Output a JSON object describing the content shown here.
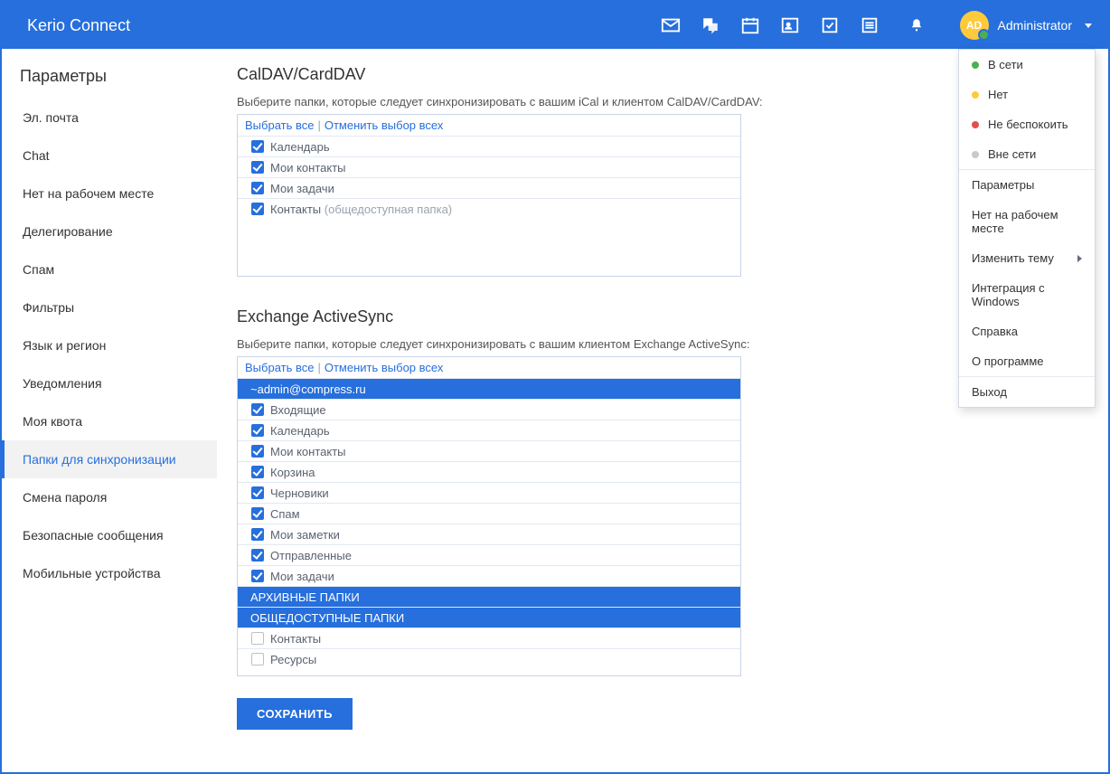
{
  "brand": "Kerio Connect",
  "user": {
    "initials": "AD",
    "name": "Administrator"
  },
  "sidebar": {
    "title": "Параметры",
    "items": [
      {
        "label": "Эл. почта"
      },
      {
        "label": "Chat"
      },
      {
        "label": "Нет на рабочем месте"
      },
      {
        "label": "Делегирование"
      },
      {
        "label": "Спам"
      },
      {
        "label": "Фильтры"
      },
      {
        "label": "Язык и регион"
      },
      {
        "label": "Уведомления"
      },
      {
        "label": "Моя квота"
      },
      {
        "label": "Папки для синхронизации",
        "active": true
      },
      {
        "label": "Смена пароля"
      },
      {
        "label": "Безопасные сообщения"
      },
      {
        "label": "Мобильные устройства"
      }
    ]
  },
  "caldav": {
    "title": "CalDAV/CardDAV",
    "desc": "Выберите папки, которые следует синхронизировать с вашим iCal и клиентом CalDAV/CardDAV:",
    "select_all": "Выбрать все",
    "deselect_all": "Отменить выбор всех",
    "rows": [
      {
        "label": "Календарь",
        "checked": true
      },
      {
        "label": "Мои контакты",
        "checked": true
      },
      {
        "label": "Мои задачи",
        "checked": true
      },
      {
        "label": "Контакты",
        "note": "(общедоступная папка)",
        "checked": true
      }
    ]
  },
  "eas": {
    "title": "Exchange ActiveSync",
    "desc": "Выберите папки, которые следует синхронизировать с вашим клиентом Exchange ActiveSync:",
    "select_all": "Выбрать все",
    "deselect_all": "Отменить выбор всех",
    "account_header": "~admin@compress.ru",
    "rows": [
      {
        "label": "Входящие",
        "checked": true
      },
      {
        "label": "Календарь",
        "checked": true
      },
      {
        "label": "Мои контакты",
        "checked": true
      },
      {
        "label": "Корзина",
        "checked": true
      },
      {
        "label": "Черновики",
        "checked": true
      },
      {
        "label": "Спам",
        "checked": true
      },
      {
        "label": "Мои заметки",
        "checked": true
      },
      {
        "label": "Отправленные",
        "checked": true
      },
      {
        "label": "Мои задачи",
        "checked": true
      }
    ],
    "section_archive": "АРХИВНЫЕ ПАПКИ",
    "section_public": "ОБЩЕДОСТУПНЫЕ ПАПКИ",
    "public_rows": [
      {
        "label": "Контакты",
        "checked": false
      },
      {
        "label": "Ресурсы",
        "checked": false
      }
    ]
  },
  "save": "СОХРАНИТЬ",
  "dropdown": {
    "status": [
      {
        "label": "В сети",
        "color": "green"
      },
      {
        "label": "Нет",
        "color": "yellow"
      },
      {
        "label": "Не беспокоить",
        "color": "red"
      },
      {
        "label": "Вне сети",
        "color": "grey"
      }
    ],
    "items": [
      {
        "label": "Параметры"
      },
      {
        "label": "Нет на рабочем месте"
      },
      {
        "label": "Изменить тему",
        "submenu": true
      },
      {
        "label": "Интеграция с Windows"
      },
      {
        "label": "Справка"
      },
      {
        "label": "О программе"
      }
    ],
    "logout": "Выход"
  }
}
